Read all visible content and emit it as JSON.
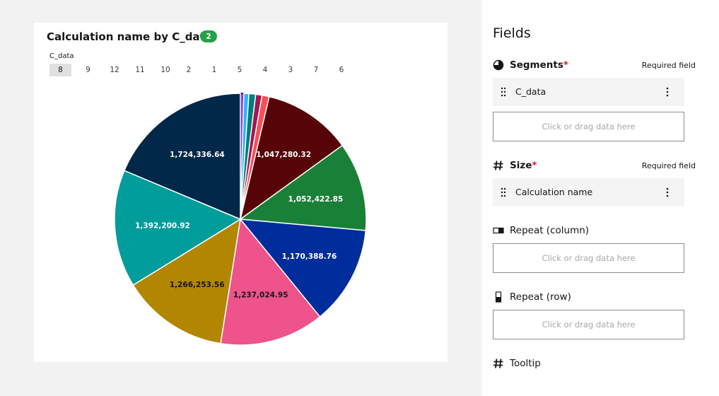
{
  "chart_card": {
    "title": "Calculation name by C_data",
    "badge": "2",
    "legend_title": "C_data",
    "legend": [
      "8",
      "9",
      "12",
      "11",
      "10",
      "2",
      "1",
      "5",
      "4",
      "3",
      "7",
      "6"
    ],
    "selected_legend": "8"
  },
  "chart_data": {
    "type": "pie",
    "title": "Calculation name by C_data",
    "slices": [
      {
        "category": "5",
        "value": 40000,
        "label": "",
        "color": "#8a3ffc",
        "highlighted": true
      },
      {
        "category": "4",
        "value": 60000,
        "label": "",
        "color": "#33b1ff"
      },
      {
        "category": "3",
        "value": 80000,
        "label": "",
        "color": "#007d79"
      },
      {
        "category": "7",
        "value": 75000,
        "label": "",
        "color": "#9f1853"
      },
      {
        "category": "6",
        "value": 85000,
        "label": "",
        "color": "#fa4d56"
      },
      {
        "category": "1",
        "value": 1047280.32,
        "label": "1,047,280.32",
        "color": "#570408"
      },
      {
        "category": "2",
        "value": 1052422.85,
        "label": "1,052,422.85",
        "color": "#198038"
      },
      {
        "category": "10",
        "value": 1170388.76,
        "label": "1,170,388.76",
        "color": "#002d9c"
      },
      {
        "category": "11",
        "value": 1237024.95,
        "label": "1,237,024.95",
        "color": "#ee538b"
      },
      {
        "category": "12",
        "value": 1266253.56,
        "label": "1,266,253.56",
        "color": "#b28600"
      },
      {
        "category": "9",
        "value": 1392200.92,
        "label": "1,392,200.92",
        "color": "#009d9a"
      },
      {
        "category": "8",
        "value": 1724336.64,
        "label": "1,724,336.64",
        "color": "#012749"
      }
    ]
  },
  "fields_panel": {
    "title": "Fields",
    "segments": {
      "label": "Segments",
      "required_text": "Required field",
      "field": "C_data"
    },
    "size": {
      "label": "Size",
      "required_text": "Required field",
      "field": "Calculation name"
    },
    "repeat_column": {
      "label": "Repeat (column)"
    },
    "repeat_row": {
      "label": "Repeat (row)"
    },
    "tooltip": {
      "label": "Tooltip"
    },
    "drop_hint": "Click or drag data here",
    "required_marker": "*"
  }
}
